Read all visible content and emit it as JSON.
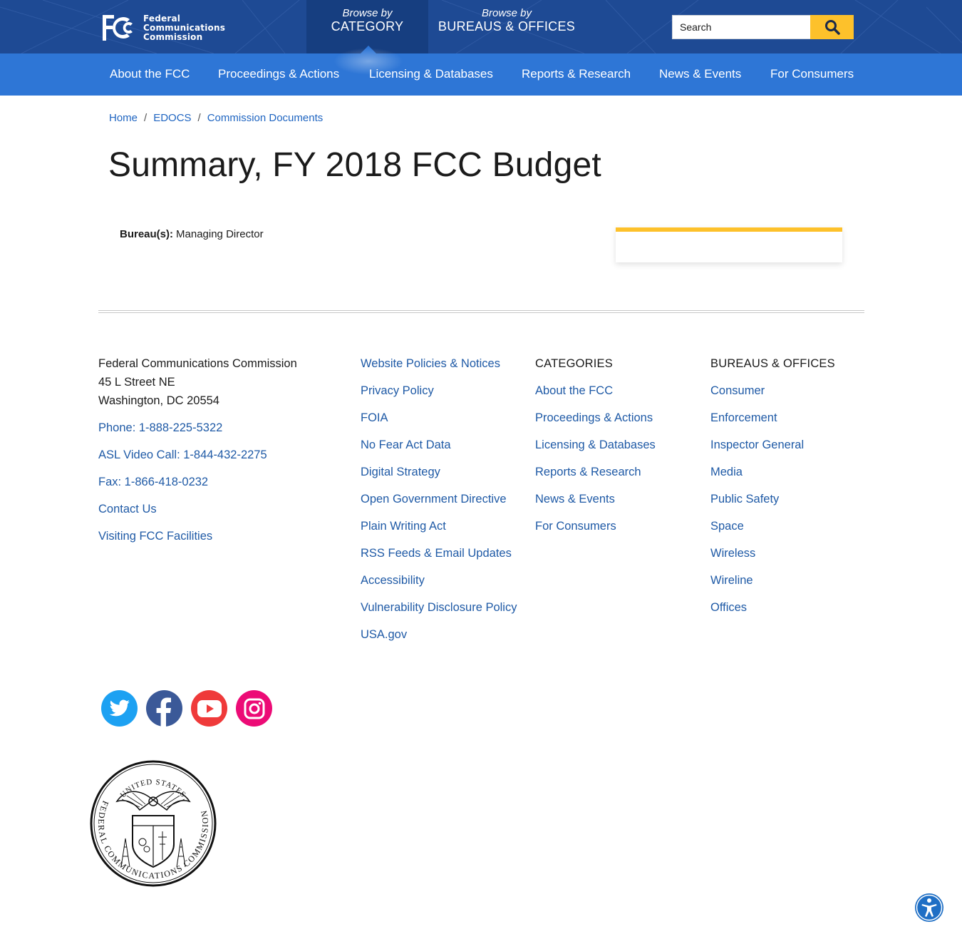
{
  "header": {
    "logo": {
      "line1": "Federal",
      "line2": "Communications",
      "line3": "Commission"
    },
    "browse_category": {
      "by": "Browse by",
      "label": "CATEGORY"
    },
    "browse_bureaus": {
      "by": "Browse by",
      "label": "BUREAUS & OFFICES"
    },
    "search": {
      "placeholder": "Search",
      "button_icon": "search-icon"
    }
  },
  "nav": {
    "items": [
      "About the FCC",
      "Proceedings & Actions",
      "Licensing & Databases",
      "Reports & Research",
      "News & Events",
      "For Consumers"
    ]
  },
  "breadcrumb": {
    "items": [
      "Home",
      "EDOCS",
      "Commission Documents"
    ],
    "separator": "/"
  },
  "page": {
    "title": "Summary, FY 2018 FCC Budget",
    "bureau_label": "Bureau(s):",
    "bureau_value": "Managing Director"
  },
  "footer": {
    "address": {
      "name": "Federal Communications Commission",
      "street": "45 L Street NE",
      "city": "Washington, DC 20554",
      "links": [
        "Phone: 1-888-225-5322",
        "ASL Video Call: 1-844-432-2275",
        "Fax: 1-866-418-0232",
        "Contact Us",
        "Visiting FCC Facilities"
      ]
    },
    "policies": [
      "Website Policies & Notices",
      "Privacy Policy",
      "FOIA",
      "No Fear Act Data",
      "Digital Strategy",
      "Open Government Directive",
      "Plain Writing Act",
      "RSS Feeds & Email Updates",
      "Accessibility",
      "Vulnerability Disclosure Policy",
      "USA.gov"
    ],
    "categories": {
      "heading": "CATEGORIES",
      "items": [
        "About the FCC",
        "Proceedings & Actions",
        "Licensing & Databases",
        "Reports & Research",
        "News & Events",
        "For Consumers"
      ]
    },
    "bureaus": {
      "heading": "BUREAUS & OFFICES",
      "items": [
        "Consumer",
        "Enforcement",
        "Inspector General",
        "Media",
        "Public Safety",
        "Space",
        "Wireless",
        "Wireline",
        "Offices"
      ]
    },
    "social": [
      {
        "name": "twitter-icon",
        "color": "#1da1f2"
      },
      {
        "name": "facebook-icon",
        "color": "#3b5998"
      },
      {
        "name": "youtube-icon",
        "color": "#ef3a3a"
      },
      {
        "name": "instagram-icon",
        "color": "#ec0b76"
      }
    ],
    "seal": {
      "top_text": "UNITED STATES",
      "ring_text": "FEDERAL COMMUNICATIONS COMMISSION"
    }
  },
  "colors": {
    "header_bg": "#1e4a94",
    "nav_bg": "#2e76d6",
    "accent_yellow": "#fdc12b",
    "link": "#1f5aa6",
    "accessibility": "#1f6fc5"
  },
  "accessibility_widget": {
    "icon": "accessibility-icon"
  }
}
